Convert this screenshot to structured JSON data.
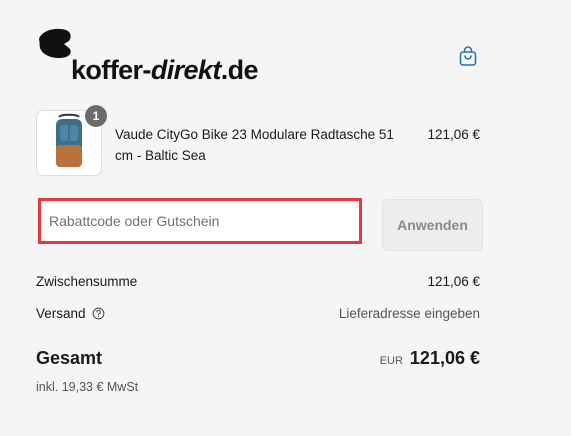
{
  "header": {
    "logo_text_bold": "koffer-",
    "logo_text_italic": "direkt",
    "logo_text_tld": ".de",
    "cart_icon": "shopping-bag-icon",
    "accent_color": "#2a73b8"
  },
  "cart": {
    "items": [
      {
        "quantity": "1",
        "name": "Vaude CityGo Bike 23 Modulare Radtasche 51 cm - Baltic Sea",
        "price": "121,06 €",
        "image": "backpack-thumbnail"
      }
    ]
  },
  "discount": {
    "placeholder": "Rabattcode oder Gutschein",
    "value": "",
    "apply_label": "Anwenden",
    "highlight_color": "#e8383d"
  },
  "summary": {
    "subtotal_label": "Zwischensumme",
    "subtotal_value": "121,06 €",
    "shipping_label": "Versand",
    "shipping_value": "Lieferadresse eingeben",
    "help_icon": "question-circle-icon",
    "total_label": "Gesamt",
    "currency": "EUR",
    "total_value": "121,06 €",
    "tax_note": "inkl. 19,33 € MwSt"
  }
}
